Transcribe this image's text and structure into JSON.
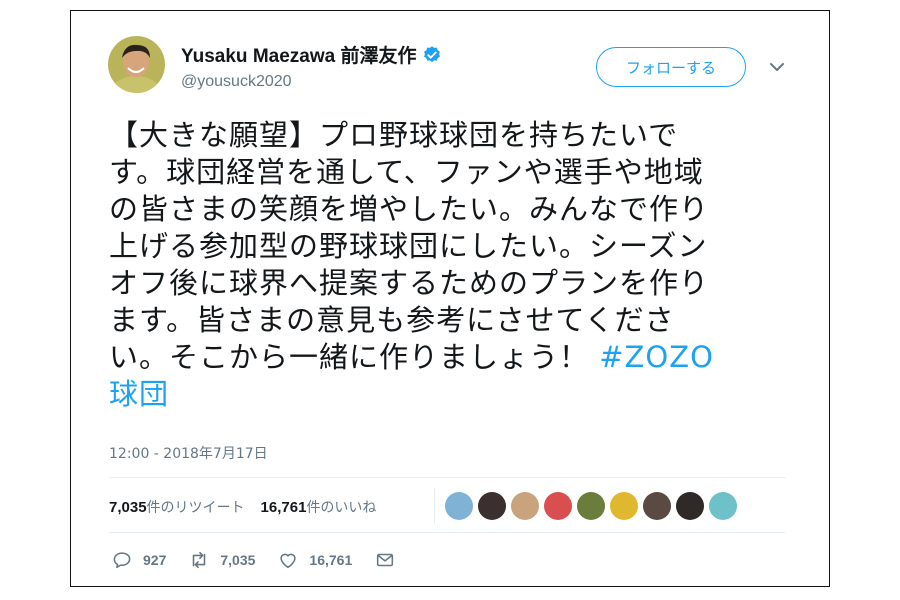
{
  "user": {
    "display_name": "Yusaku Maezawa 前澤友作",
    "handle": "@yousuck2020",
    "avatar": "avatar-photo",
    "verified_icon": "verified-badge-icon"
  },
  "follow_button_label": "フォローする",
  "menu_icon": "chevron-down-icon",
  "tweet": {
    "lines": [
      "【大きな願望】プロ野球球団を持ちたいで",
      "す。球団経営を通して、ファンや選手や地域",
      "の皆さまの笑顔を増やしたい。みんなで作り",
      "上げる参加型の野球球団にしたい。シーズン",
      "オフ後に球界へ提案するためのプランを作り",
      "ます。皆さまの意見も参考にさせてくださ",
      "い。そこから一緒に作りましょう！"
    ],
    "hashtag_part1": "#ZOZO",
    "hashtag_part2": "球団"
  },
  "timestamp": "12:00 - 2018年7月17日",
  "stats": {
    "retweets_count": "7,035",
    "retweets_label": "件のリツイート",
    "likes_count": "16,761",
    "likes_label": "件のいいね"
  },
  "liker_avatars": [
    {
      "name": "liker-avatar-1",
      "color": "#7fb3d5"
    },
    {
      "name": "liker-avatar-2",
      "color": "#3b2f2f"
    },
    {
      "name": "liker-avatar-3",
      "color": "#c9a27e"
    },
    {
      "name": "liker-avatar-4",
      "color": "#d94f4f"
    },
    {
      "name": "liker-avatar-5",
      "color": "#6b7d3a"
    },
    {
      "name": "liker-avatar-6",
      "color": "#e0b830"
    },
    {
      "name": "liker-avatar-7",
      "color": "#5a4a42"
    },
    {
      "name": "liker-avatar-8",
      "color": "#2f2a28"
    },
    {
      "name": "liker-avatar-9",
      "color": "#6fc1c9"
    }
  ],
  "actions": {
    "reply_count": "927",
    "retweet_count": "7,035",
    "like_count": "16,761"
  },
  "colors": {
    "accent": "#1da1f2",
    "secondary_text": "#657786"
  }
}
